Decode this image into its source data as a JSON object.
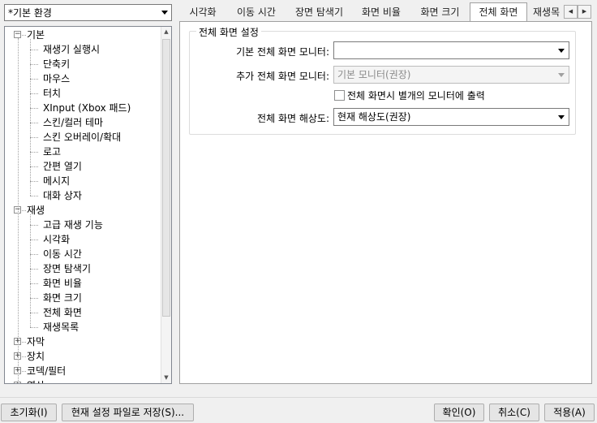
{
  "profile": {
    "value": "*기본 환경"
  },
  "tree": {
    "nodes": [
      {
        "label": "기본",
        "expander": "−"
      },
      {
        "label": "재생기 실행시"
      },
      {
        "label": "단축키"
      },
      {
        "label": "마우스"
      },
      {
        "label": "터치"
      },
      {
        "label": "XInput (Xbox 패드)"
      },
      {
        "label": "스킨/컬러 테마"
      },
      {
        "label": "스킨 오버레이/확대"
      },
      {
        "label": "로고"
      },
      {
        "label": "간편 열기"
      },
      {
        "label": "메시지"
      },
      {
        "label": "대화 상자"
      },
      {
        "label": "재생",
        "expander": "−"
      },
      {
        "label": "고급 재생 기능"
      },
      {
        "label": "시각화"
      },
      {
        "label": "이동 시간"
      },
      {
        "label": "장면 탐색기"
      },
      {
        "label": "화면 비율"
      },
      {
        "label": "화면 크기"
      },
      {
        "label": "전체 화면"
      },
      {
        "label": "재생목록"
      },
      {
        "label": "자막",
        "expander": "+"
      },
      {
        "label": "장치",
        "expander": "+"
      },
      {
        "label": "코덱/필터",
        "expander": "+"
      },
      {
        "label": "영상",
        "expander": "+"
      }
    ]
  },
  "tabs": [
    {
      "label": "시각화"
    },
    {
      "label": "이동 시간"
    },
    {
      "label": "장면 탐색기"
    },
    {
      "label": "화면 비율"
    },
    {
      "label": "화면 크기"
    },
    {
      "label": "전체 화면"
    },
    {
      "label": "재생목"
    }
  ],
  "fullscreen": {
    "group_title": "전체 화면 설정",
    "primary_monitor_label": "기본 전체 화면 모니터:",
    "primary_monitor_value": "",
    "secondary_monitor_label": "추가 전체 화면 모니터:",
    "secondary_monitor_value": "기본 모니터(권장)",
    "separate_output_label": "전체 화면시 별개의 모니터에 출력",
    "resolution_label": "전체 화면 해상도:",
    "resolution_value": "현재 해상도(권장)"
  },
  "buttons": {
    "reset": "초기화(I)",
    "save_profile": "현재 설정 파일로 저장(S)...",
    "ok": "확인(O)",
    "cancel": "취소(C)",
    "apply": "적용(A)"
  }
}
